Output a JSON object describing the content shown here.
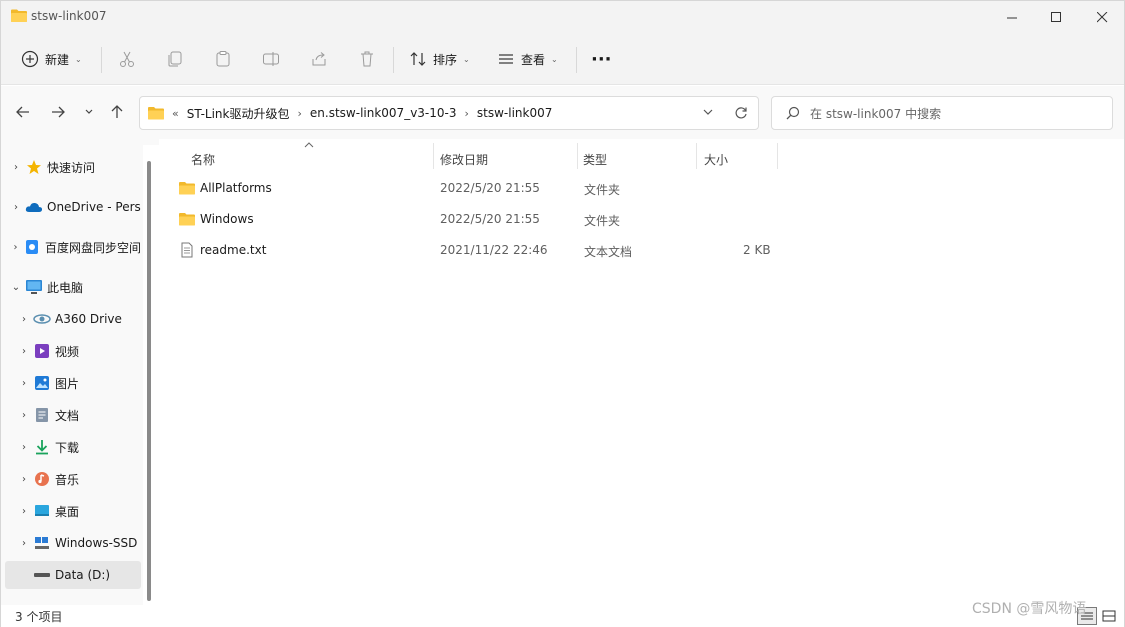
{
  "window": {
    "title": "stsw-link007",
    "controls": {
      "minimize": "—",
      "maximize": "☐",
      "close": "✕"
    }
  },
  "toolbar": {
    "new_label": "新建",
    "sort_label": "排序",
    "view_label": "查看",
    "more_label": "···",
    "icons": [
      "cut-icon",
      "copy-icon",
      "paste-icon",
      "rename-icon",
      "share-icon",
      "delete-icon"
    ]
  },
  "address": {
    "overflow": "«",
    "crumbs": [
      "ST-Link驱动升级包",
      "en.stsw-link007_v3-10-3",
      "stsw-link007"
    ]
  },
  "search": {
    "placeholder": "在 stsw-link007 中搜索"
  },
  "sidebar": {
    "items": [
      {
        "label": "快速访问",
        "icon": "star-icon",
        "chevron": "›"
      },
      {
        "label": "OneDrive - Pers",
        "icon": "cloud-icon",
        "chevron": "›"
      },
      {
        "label": "百度网盘同步空间",
        "icon": "baidu-icon",
        "chevron": "›"
      },
      {
        "label": "此电脑",
        "icon": "pc-icon",
        "chevron": "⌄"
      },
      {
        "label": "A360 Drive",
        "icon": "a360-icon",
        "chevron": "›"
      },
      {
        "label": "视频",
        "icon": "video-icon",
        "chevron": "›"
      },
      {
        "label": "图片",
        "icon": "picture-icon",
        "chevron": "›"
      },
      {
        "label": "文档",
        "icon": "document-icon",
        "chevron": "›"
      },
      {
        "label": "下载",
        "icon": "download-icon",
        "chevron": "›"
      },
      {
        "label": "音乐",
        "icon": "music-icon",
        "chevron": "›"
      },
      {
        "label": "桌面",
        "icon": "desktop-icon",
        "chevron": "›"
      },
      {
        "label": "Windows-SSD",
        "icon": "drive-icon",
        "chevron": "›"
      },
      {
        "label": "Data (D:)",
        "icon": "drive-icon",
        "chevron": "›"
      }
    ]
  },
  "columns": {
    "name": "名称",
    "modified": "修改日期",
    "type": "类型",
    "size": "大小"
  },
  "files": [
    {
      "name": "AllPlatforms",
      "modified": "2022/5/20 21:55",
      "type": "文件夹",
      "size": "",
      "icon": "folder-icon"
    },
    {
      "name": "Windows",
      "modified": "2022/5/20 21:55",
      "type": "文件夹",
      "size": "",
      "icon": "folder-icon"
    },
    {
      "name": "readme.txt",
      "modified": "2021/11/22 22:46",
      "type": "文本文档",
      "size": "2 KB",
      "icon": "text-file-icon"
    }
  ],
  "status": {
    "item_count": "3 个项目"
  },
  "watermark": "CSDN @雪风物语"
}
